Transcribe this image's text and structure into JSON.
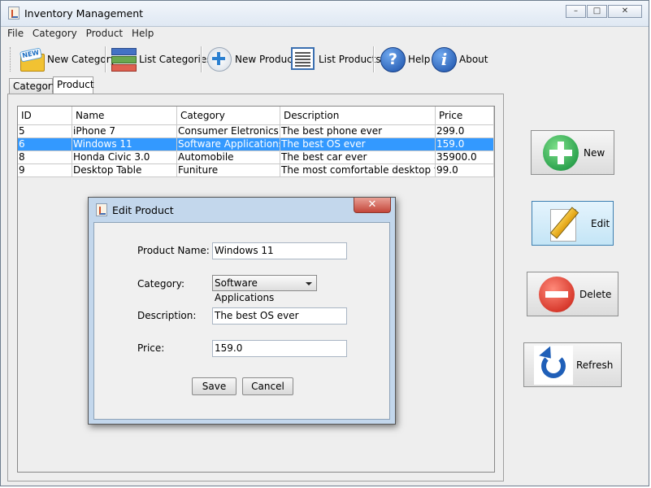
{
  "window": {
    "title": "Inventory Management",
    "min": "–",
    "max": "□",
    "close": "✕"
  },
  "menu": [
    "File",
    "Category",
    "Product",
    "Help"
  ],
  "toolbar": {
    "new_category": "New Category",
    "new_badge": "NEW",
    "list_categories": "List Categories",
    "new_product": "New Product",
    "list_products": "List Products",
    "help": "Help",
    "help_glyph": "?",
    "about": "About",
    "about_glyph": "i"
  },
  "tabs": [
    "Category",
    "Product"
  ],
  "table": {
    "columns": [
      "ID",
      "Name",
      "Category",
      "Description",
      "Price"
    ],
    "rows": [
      [
        "5",
        "iPhone 7",
        "Consumer Eletronics",
        "The best phone ever",
        "299.0"
      ],
      [
        "6",
        "Windows 11",
        "Software Applications",
        "The best OS ever",
        "159.0"
      ],
      [
        "8",
        "Honda Civic 3.0",
        "Automobile",
        "The best car ever",
        "35900.0"
      ],
      [
        "9",
        "Desktop Table",
        "Funiture",
        "The most comfortable desktop table",
        "99.0"
      ]
    ]
  },
  "actions": {
    "new": "New",
    "edit": "Edit",
    "delete": "Delete",
    "refresh": "Refresh"
  },
  "dialog": {
    "title": "Edit Product",
    "close": "✕",
    "product_name_label": "Product Name:",
    "product_name_value": "Windows 11",
    "category_label": "Category:",
    "category_value": "Software Applications",
    "description_label": "Description:",
    "description_value": "The best OS ever",
    "price_label": "Price:",
    "price_value": "159.0",
    "save": "Save",
    "cancel": "Cancel"
  },
  "colors": {
    "selection": "#3399ff",
    "accent_green": "#2ea44f",
    "accent_red": "#d83b2e",
    "accent_blue": "#1f5fb8"
  }
}
